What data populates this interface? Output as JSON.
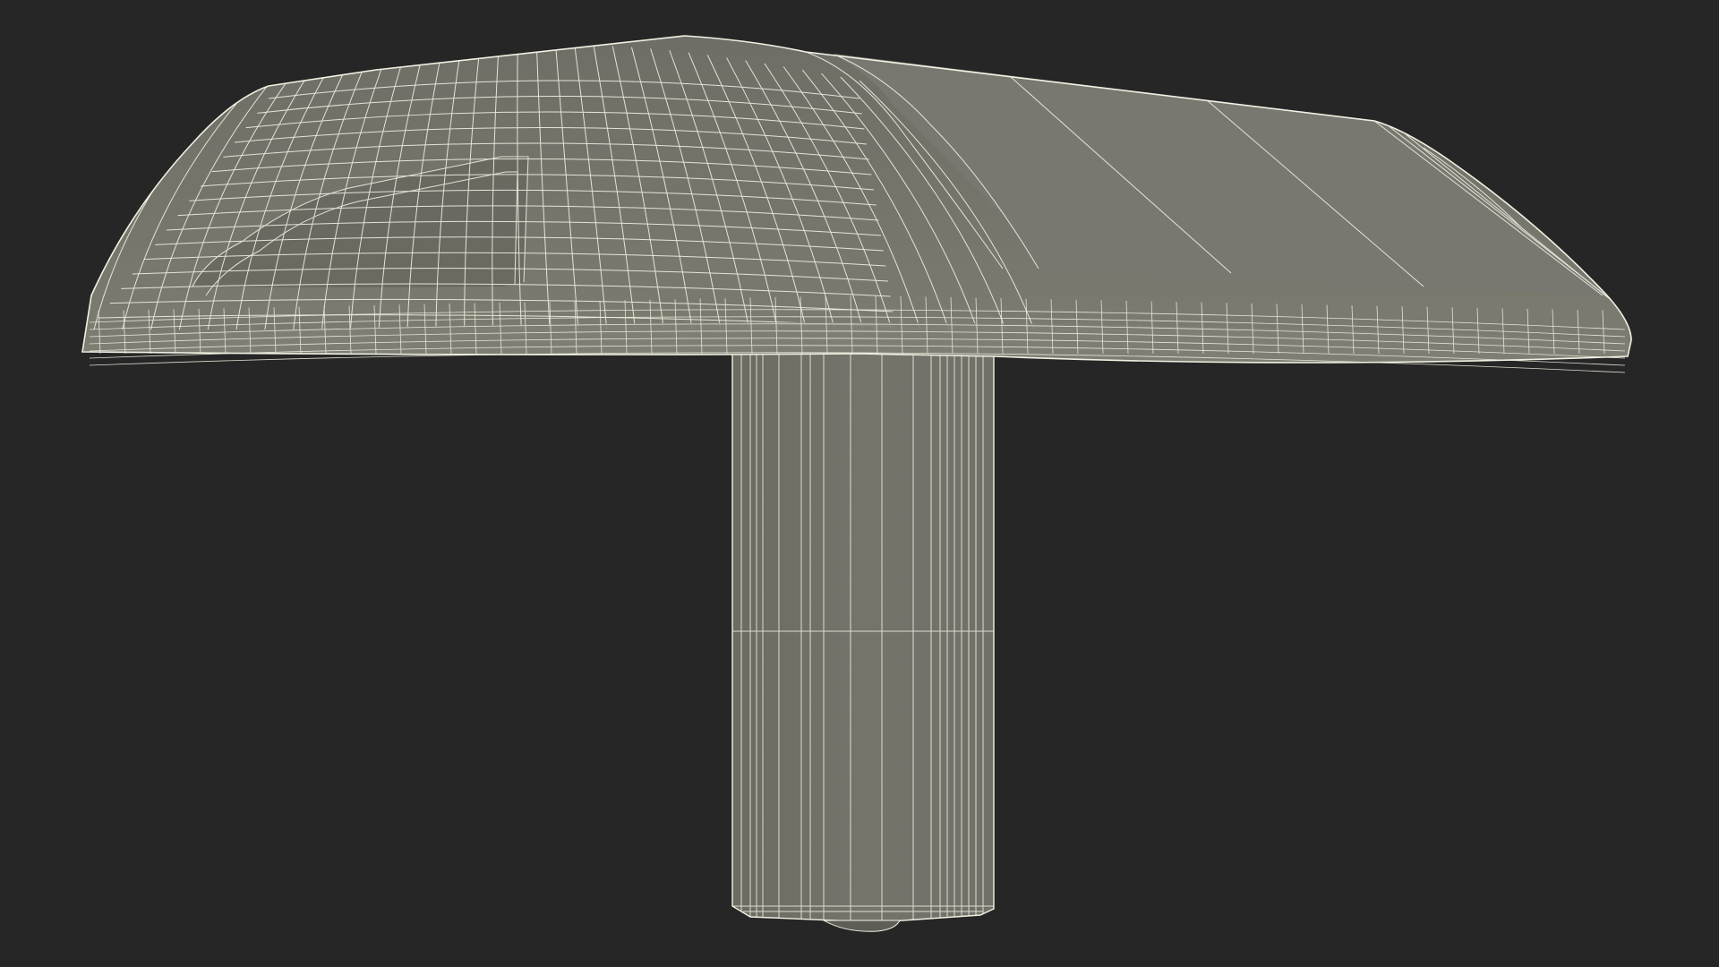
{
  "scene": {
    "background_color": "#262626",
    "surface_color": "#76766c",
    "surface_dark_color": "#6a6a61",
    "wire_color": "#f2f0e2",
    "subject": "wireframe-render"
  }
}
